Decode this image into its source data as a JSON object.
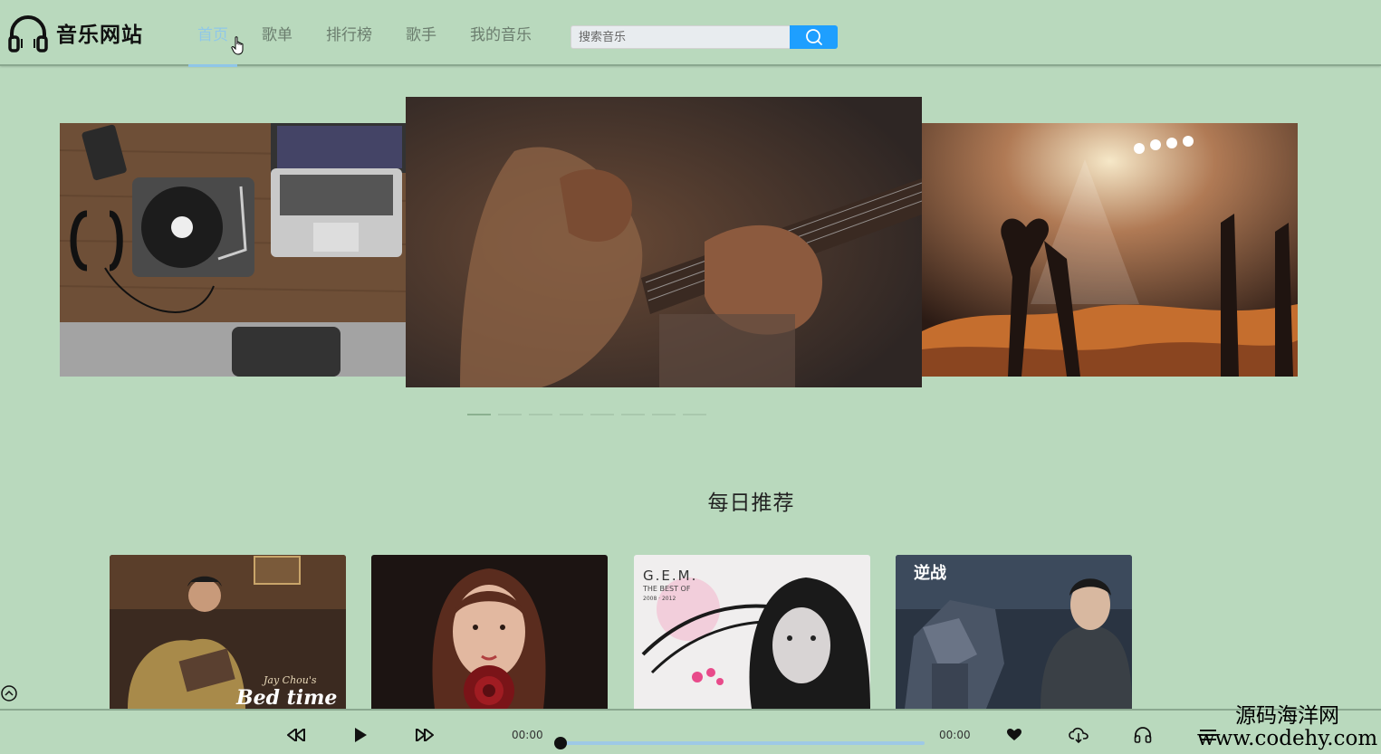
{
  "header": {
    "site_name": "音乐网站",
    "nav": [
      {
        "label": "首页",
        "active": true
      },
      {
        "label": "歌单",
        "active": false
      },
      {
        "label": "排行榜",
        "active": false
      },
      {
        "label": "歌手",
        "active": false
      },
      {
        "label": "我的音乐",
        "active": false
      }
    ],
    "search": {
      "placeholder": "搜索音乐",
      "value": "",
      "button_icon": "search-icon"
    }
  },
  "carousel": {
    "slides": [
      {
        "name": "turntable-laptop-photo"
      },
      {
        "name": "guitar-playing-photo"
      },
      {
        "name": "concert-crowd-photo"
      }
    ],
    "dot_count": 8,
    "active_dot": 0
  },
  "recommend": {
    "title": "每日推荐",
    "cards": [
      {
        "name": "album-cover-bedtime",
        "cover_text": "Bed time",
        "cover_subtext": "Jay Chou's"
      },
      {
        "name": "album-cover-portrait-rose"
      },
      {
        "name": "album-cover-gem",
        "cover_text": "G.E.M.",
        "cover_subtext": "THE BEST OF",
        "cover_years": "2008 · 2012"
      },
      {
        "name": "album-cover-nizhan",
        "cover_text": "逆战"
      }
    ]
  },
  "player": {
    "current_time": "00:00",
    "total_time": "00:00",
    "progress": 0,
    "controls": [
      "prev-icon",
      "play-icon",
      "next-icon",
      "heart-icon",
      "download-icon",
      "headphones-icon",
      "playlist-icon"
    ]
  },
  "watermark": {
    "text_cn": "源码海洋网",
    "url": "www.codehy.com"
  },
  "colors": {
    "background": "#b9d9bd",
    "accent": "#1e9fff",
    "nav_active": "#90c8e8"
  }
}
